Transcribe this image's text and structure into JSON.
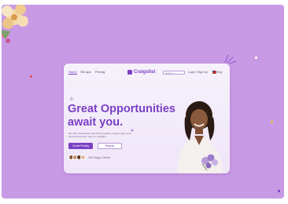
{
  "nav": {
    "links": [
      "Home",
      "Stir app",
      "Pricing"
    ],
    "logo": "Craigslist",
    "search_placeholder": "Search...",
    "login": "Login / Sign Up",
    "language": "Eng"
  },
  "hero": {
    "title_line1": "Great Opportunities",
    "title_line2": "await you.",
    "subtitle": "We offer customized opportunity workers, explore gigs, your houses and more more on craigslist.",
    "primary_button": "Create Posting",
    "secondary_button": "Register",
    "users_text": "10k Happy Clients"
  },
  "colors": {
    "background": "#c89ae6",
    "accent": "#7a3fc4"
  }
}
